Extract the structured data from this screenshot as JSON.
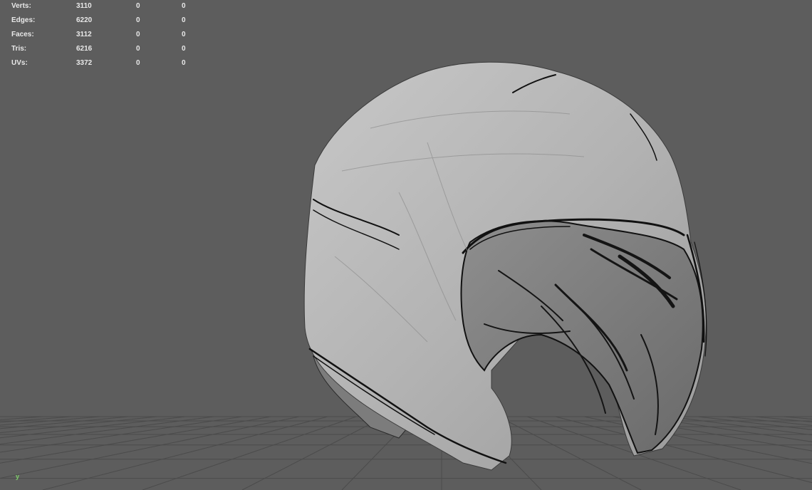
{
  "hud": {
    "rows": [
      {
        "label": "Verts:",
        "total": "3110",
        "selected": "0",
        "component": "0"
      },
      {
        "label": "Edges:",
        "total": "6220",
        "selected": "0",
        "component": "0"
      },
      {
        "label": "Faces:",
        "total": "3112",
        "selected": "0",
        "component": "0"
      },
      {
        "label": "Tris:",
        "total": "6216",
        "selected": "0",
        "component": "0"
      },
      {
        "label": "UVs:",
        "total": "3372",
        "selected": "0",
        "component": "0"
      }
    ]
  },
  "axis": {
    "up_label": "y"
  },
  "colors": {
    "background": "#5d5d5d",
    "grid": "#4a4a4a",
    "model_light": "#bcbcbc",
    "model_mid": "#a4a4a4",
    "model_dark": "#1a1a1a",
    "hud_text": "#e8e8e8",
    "axis_y": "#7fd06a"
  }
}
